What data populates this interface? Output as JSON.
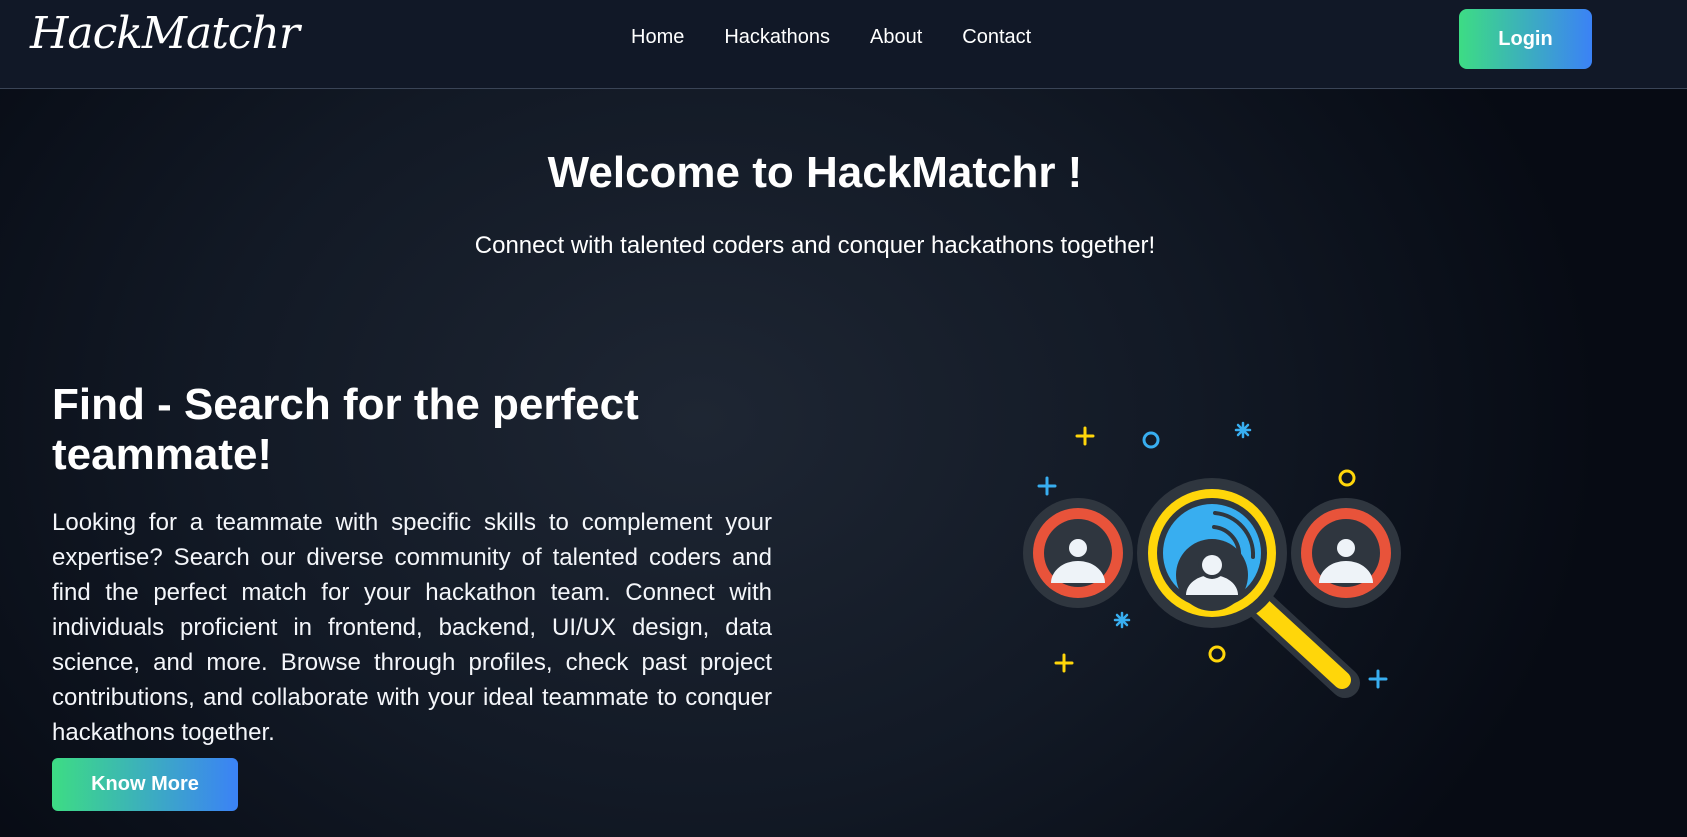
{
  "header": {
    "logo_text": "HackMatchr",
    "nav": [
      "Home",
      "Hackathons",
      "About",
      "Contact"
    ],
    "login_label": "Login"
  },
  "hero": {
    "title": "Welcome to HackMatchr !",
    "subtitle": "Connect with talented coders and conquer hackathons together!"
  },
  "feature": {
    "title": "Find - Search for the perfect teammate!",
    "description": "Looking for a teammate with specific skills to complement your expertise? Search our diverse community of talented coders and find the perfect match for your hackathon team. Connect with individuals proficient in frontend, backend, UI/UX design, data science, and more. Browse through profiles, check past project contributions, and collaborate with your ideal teammate to conquer hackathons together.",
    "button_label": "Know More",
    "illustration_icon": "search-people-illustration"
  },
  "colors": {
    "background": "#111827",
    "accent_green": "#3ddc84",
    "accent_blue": "#3b82f6",
    "magnifier_yellow": "#ffd60a",
    "avatar_red": "#e8533a",
    "avatar_blue": "#38aef0"
  }
}
